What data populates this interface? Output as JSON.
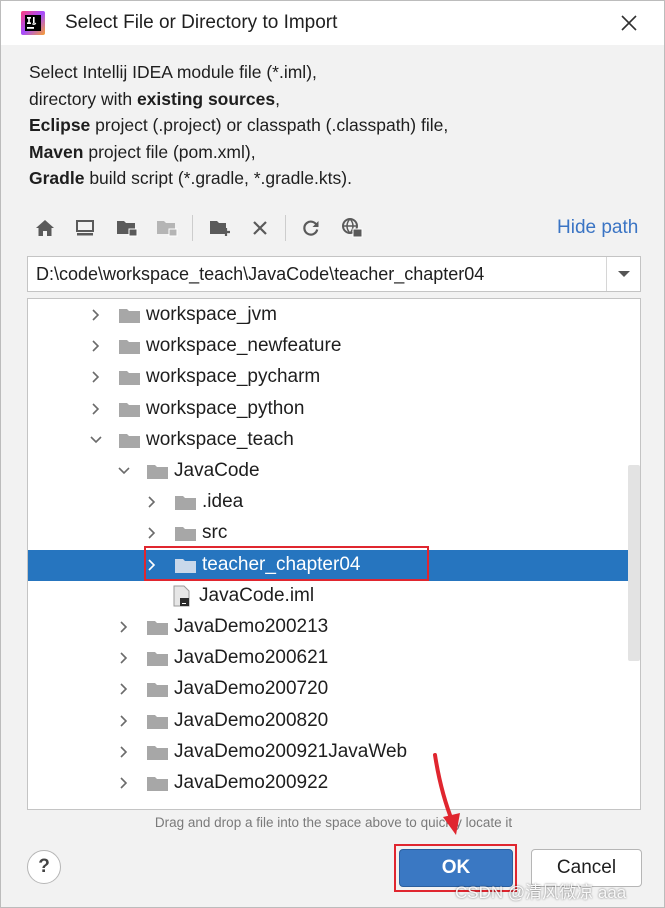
{
  "window": {
    "title": "Select File or Directory to Import"
  },
  "description": {
    "line1": "Select Intellij IDEA module file (*.iml),",
    "line2_pre": "directory with ",
    "line2_bold": "existing sources",
    "line2_post": ",",
    "line3_bold": "Eclipse",
    "line3_rest": " project (.project) or classpath (.classpath) file,",
    "line4_bold": "Maven",
    "line4_rest": " project file (pom.xml),",
    "line5_bold": "Gradle",
    "line5_rest": " build script (*.gradle, *.gradle.kts)."
  },
  "toolbar": {
    "icons": [
      "home-icon",
      "desktop-icon",
      "project-folder-icon",
      "module-folder-icon",
      "new-folder-icon",
      "delete-icon",
      "refresh-icon",
      "show-hidden-icon"
    ],
    "hide_path_label": "Hide path"
  },
  "path": {
    "value": "D:\\code\\workspace_teach\\JavaCode\\teacher_chapter04"
  },
  "tree": {
    "rows": [
      {
        "label": "workspace_jvm",
        "expanded": false,
        "type": "folder"
      },
      {
        "label": "workspace_newfeature",
        "expanded": false,
        "type": "folder"
      },
      {
        "label": "workspace_pycharm",
        "expanded": false,
        "type": "folder"
      },
      {
        "label": "workspace_python",
        "expanded": false,
        "type": "folder"
      },
      {
        "label": "workspace_teach",
        "expanded": true,
        "type": "folder"
      },
      {
        "label": "JavaCode",
        "expanded": true,
        "type": "folder"
      },
      {
        "label": ".idea",
        "expanded": false,
        "type": "folder"
      },
      {
        "label": "src",
        "expanded": false,
        "type": "folder"
      },
      {
        "label": "teacher_chapter04",
        "expanded": false,
        "type": "folder",
        "selected": true
      },
      {
        "label": "JavaCode.iml",
        "type": "file"
      },
      {
        "label": "JavaDemo200213",
        "expanded": false,
        "type": "folder"
      },
      {
        "label": "JavaDemo200621",
        "expanded": false,
        "type": "folder"
      },
      {
        "label": "JavaDemo200720",
        "expanded": false,
        "type": "folder"
      },
      {
        "label": "JavaDemo200820",
        "expanded": false,
        "type": "folder"
      },
      {
        "label": "JavaDemo200921JavaWeb",
        "expanded": false,
        "type": "folder"
      },
      {
        "label": "JavaDemo200922",
        "expanded": false,
        "type": "folder"
      }
    ]
  },
  "hint": "Drag and drop a file into the space above to quickly locate it",
  "buttons": {
    "help": "?",
    "ok": "OK",
    "cancel": "Cancel"
  },
  "watermark": "CSDN @清风微凉 aaa",
  "colors": {
    "selection": "#2675bf",
    "accent": "#3a74c4",
    "highlight_outline": "#e0262f"
  }
}
